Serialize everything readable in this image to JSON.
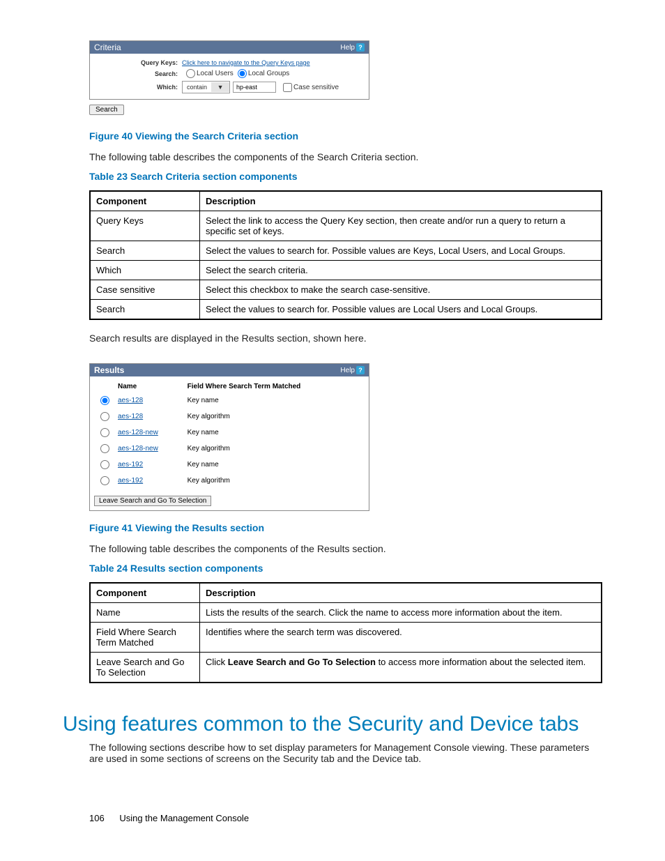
{
  "criteria_panel": {
    "title": "Criteria",
    "help_label": "Help",
    "rows": {
      "query_keys_label": "Query Keys:",
      "query_keys_link": "Click here to navigate to the Query Keys page",
      "search_label": "Search:",
      "radio1": "Local Users",
      "radio2": "Local Groups",
      "which_label": "Which:",
      "which_select": "contain",
      "which_input": "hp-east",
      "case_label": "Case sensitive"
    },
    "search_button": "Search"
  },
  "fig40": "Figure 40 Viewing the Search Criteria section",
  "para1": "The following table describes the components of the Search Criteria section.",
  "tbl23_caption": "Table 23 Search Criteria section components",
  "tbl23": {
    "h1": "Component",
    "h2": "Description",
    "rows": [
      {
        "c": "Query Keys",
        "d": "Select the link to access the Query Key section, then create and/or run a query to return a specific set of keys."
      },
      {
        "c": "Search",
        "d": "Select the values to search for.  Possible values are Keys, Local Users, and Local Groups."
      },
      {
        "c": "Which",
        "d": "Select the search criteria."
      },
      {
        "c": "Case sensitive",
        "d": "Select this checkbox to make the search case-sensitive."
      },
      {
        "c": "Search",
        "d": "Select the values to search for.  Possible values are Local Users and Local Groups."
      }
    ]
  },
  "para2": "Search results are displayed in the Results section, shown here.",
  "results_panel": {
    "title": "Results",
    "help_label": "Help",
    "col1": "Name",
    "col2": "Field Where Search Term Matched",
    "rows": [
      {
        "n": "aes-128",
        "f": "Key name",
        "sel": true
      },
      {
        "n": "aes-128",
        "f": "Key algorithm",
        "sel": false
      },
      {
        "n": "aes-128-new",
        "f": "Key name",
        "sel": false
      },
      {
        "n": "aes-128-new",
        "f": "Key algorithm",
        "sel": false
      },
      {
        "n": "aes-192",
        "f": "Key name",
        "sel": false
      },
      {
        "n": "aes-192",
        "f": "Key algorithm",
        "sel": false
      }
    ],
    "button": "Leave Search and Go To Selection"
  },
  "fig41": "Figure 41 Viewing the Results section",
  "para3": "The following table describes the components of the Results section.",
  "tbl24_caption": "Table 24 Results section components",
  "tbl24": {
    "h1": "Component",
    "h2": "Description",
    "rows": [
      {
        "c": "Name",
        "d": "Lists the results of the search.  Click the name to access more information about the item."
      },
      {
        "c": "Field Where Search Term Matched",
        "d": "Identifies where the search term was discovered."
      },
      {
        "c": "Leave Search and Go To Selection",
        "d_pre": "Click ",
        "d_bold": "Leave Search and Go To Selection",
        "d_post": " to access more information about the selected item."
      }
    ]
  },
  "heading": "Using features common to the Security and Device tabs",
  "para4": "The following sections describe how to set display parameters for Management Console viewing.  These parameters are used in some sections of screens on the Security tab and the Device tab.",
  "footer": {
    "page": "106",
    "text": "Using the Management Console"
  }
}
